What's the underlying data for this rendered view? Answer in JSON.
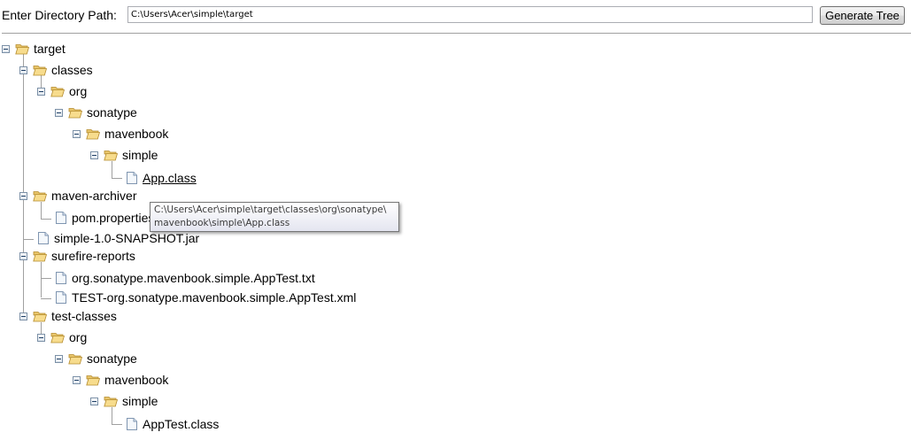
{
  "toolbar": {
    "path_label": "Enter Directory Path:",
    "path_value": "C:\\Users\\Acer\\simple\\target",
    "generate_label": "Generate Tree"
  },
  "tree": {
    "target": "target",
    "classes": "classes",
    "org1": "org",
    "sonatype1": "sonatype",
    "mavenbook1": "mavenbook",
    "simple1": "simple",
    "app_class": "App.class",
    "maven_archiver": "maven-archiver",
    "pom_properties": "pom.properties",
    "jar": "simple-1.0-SNAPSHOT.jar",
    "surefire_reports": "surefire-reports",
    "apptest_txt": "org.sonatype.mavenbook.simple.AppTest.txt",
    "apptest_xml": "TEST-org.sonatype.mavenbook.simple.AppTest.xml",
    "test_classes": "test-classes",
    "org2": "org",
    "sonatype2": "sonatype",
    "mavenbook2": "mavenbook",
    "simple2": "simple",
    "apptest_class": "AppTest.class"
  },
  "tooltip": {
    "line1": "C:\\Users\\Acer\\simple\\target\\classes\\org\\sonatype\\",
    "line2": "mavenbook\\simple\\App.class"
  }
}
